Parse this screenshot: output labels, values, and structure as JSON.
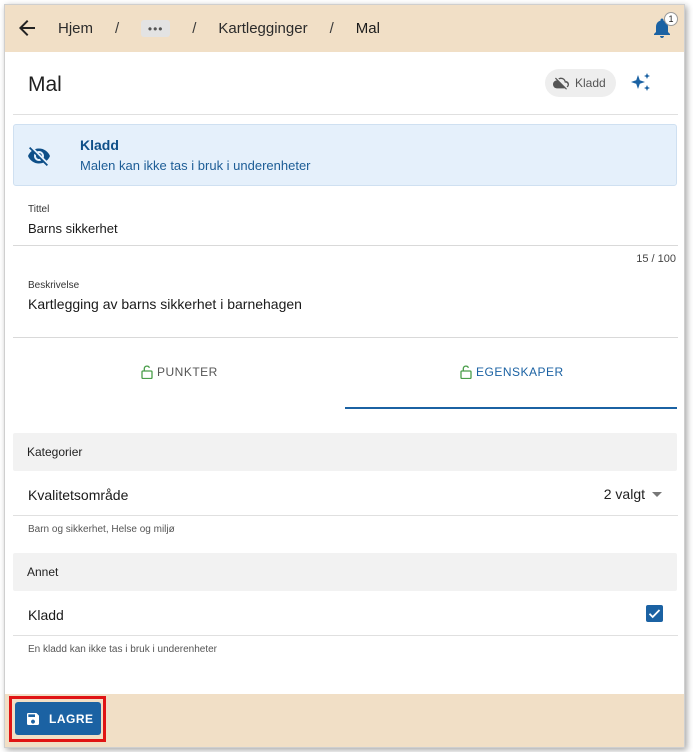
{
  "header": {
    "breadcrumbs": [
      "Hjem",
      "Kartlegginger",
      "Mal"
    ],
    "separator": "/",
    "ellipsis": "•••",
    "notification_count": "1"
  },
  "page": {
    "title": "Mal",
    "status_chip": "Kladd"
  },
  "alert": {
    "title": "Kladd",
    "message": "Malen kan ikke tas i bruk i underenheter"
  },
  "form": {
    "title_label": "Tittel",
    "title_value": "Barns sikkerhet",
    "title_counter": "15 / 100",
    "description_label": "Beskrivelse",
    "description_value": "Kartlegging av barns sikkerhet i barnehagen"
  },
  "tabs": [
    {
      "label": "PUNKTER",
      "active": false
    },
    {
      "label": "EGENSKAPER",
      "active": true
    }
  ],
  "categories": {
    "header": "Kategorier",
    "field_label": "Kvalitetsområde",
    "selected": "2 valgt",
    "helper": "Barn og sikkerhet, Helse og miljø"
  },
  "other": {
    "header": "Annet",
    "field_label": "Kladd",
    "checked": true,
    "helper": "En kladd kan ikke tas i bruk i underenheter"
  },
  "footer": {
    "save_label": "LAGRE"
  },
  "colors": {
    "topbar": "#f1dfc6",
    "primary": "#1b62a3",
    "alert_bg": "#e5f0fb",
    "highlight": "#e01414"
  }
}
